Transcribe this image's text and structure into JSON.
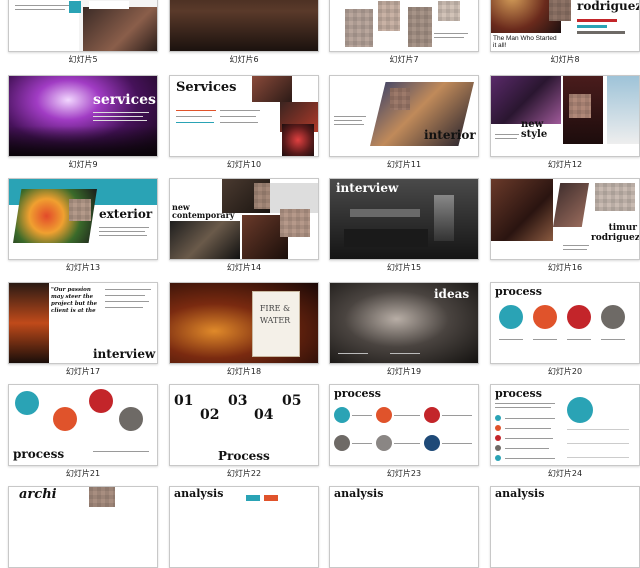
{
  "slides": [
    {
      "caption": "幻灯片5"
    },
    {
      "caption": "幻灯片6"
    },
    {
      "caption": "幻灯片7"
    },
    {
      "caption": "幻灯片8",
      "title": "rodriguez",
      "subtitle": "The Man Who Started it all!"
    },
    {
      "caption": "幻灯片9",
      "title": "services"
    },
    {
      "caption": "幻灯片10",
      "title": "Services"
    },
    {
      "caption": "幻灯片11",
      "title": "interior"
    },
    {
      "caption": "幻灯片12",
      "title": "new style"
    },
    {
      "caption": "幻灯片13",
      "title": "exterior"
    },
    {
      "caption": "幻灯片14",
      "title": "new contemporary"
    },
    {
      "caption": "幻灯片15",
      "title": "interview"
    },
    {
      "caption": "幻灯片16",
      "title": "timur rodriguez"
    },
    {
      "caption": "幻灯片17",
      "title": "interview",
      "quote": "\"Our passion may steer the project but the client is at the"
    },
    {
      "caption": "幻灯片18",
      "title": "FIRE & WATER"
    },
    {
      "caption": "幻灯片19",
      "title": "ideas"
    },
    {
      "caption": "幻灯片20",
      "title": "process"
    },
    {
      "caption": "幻灯片21",
      "title": "process"
    },
    {
      "caption": "幻灯片22",
      "title": "Process",
      "numbers": [
        "01",
        "02",
        "03",
        "04",
        "05"
      ]
    },
    {
      "caption": "幻灯片23",
      "title": "process"
    },
    {
      "caption": "幻灯片24",
      "title": "process"
    },
    {
      "caption": "",
      "title": "archi"
    },
    {
      "caption": "",
      "title": "analysis"
    },
    {
      "caption": "",
      "title": "analysis"
    },
    {
      "caption": "",
      "title": "analysis"
    }
  ],
  "colors": {
    "teal": "#2aa3b5",
    "orange": "#e0532b",
    "red": "#c3252a",
    "gray": "#6e6a66",
    "dark": "#1c1a1a"
  }
}
